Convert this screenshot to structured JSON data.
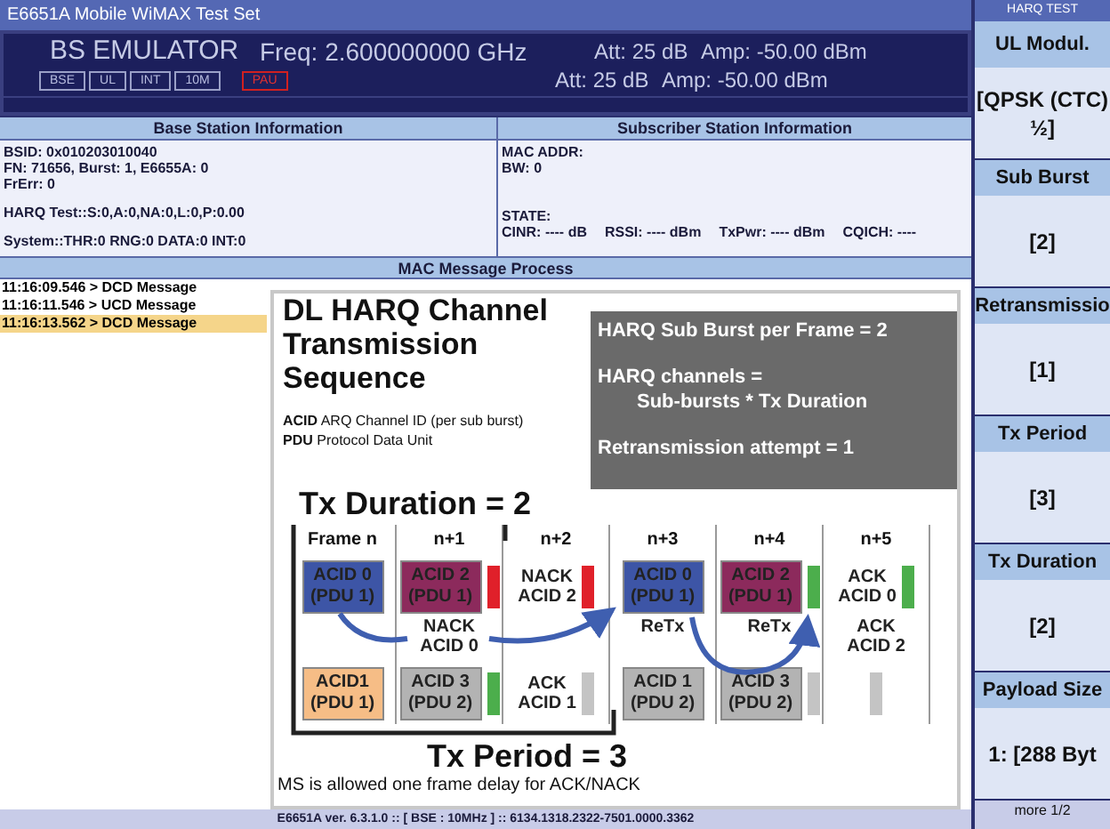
{
  "window": {
    "title": "E6651A Mobile WiMAX Test Set"
  },
  "emulator": {
    "mode": "BS EMULATOR",
    "freq": "Freq: 2.600000000 GHz",
    "lines": [
      {
        "att": "Att: 25 dB",
        "amp": "Amp: -50.00 dBm"
      },
      {
        "att": "Att: 25 dB",
        "amp": "Amp: -50.00 dBm"
      }
    ],
    "indicators": [
      {
        "label": "BSE",
        "kind": "normal"
      },
      {
        "label": "UL",
        "kind": "normal"
      },
      {
        "label": "INT",
        "kind": "normal"
      },
      {
        "label": "10M",
        "kind": "normal"
      },
      {
        "label": "PAU",
        "kind": "alert"
      }
    ]
  },
  "base_station": {
    "title": "Base Station Information",
    "groups": [
      [
        "BSID: 0x010203010040",
        "FN:   71656, Burst: 1, E6655A: 0",
        "FrErr: 0"
      ],
      [
        "HARQ Test::S:0,A:0,NA:0,L:0,P:0.00"
      ],
      [
        "System::THR:0 RNG:0 DATA:0 INT:0"
      ]
    ]
  },
  "subscriber": {
    "title": "Subscriber Station Information",
    "groups": [
      [
        "MAC ADDR:",
        "BW: 0"
      ],
      [
        "STATE:"
      ]
    ],
    "metrics": [
      "CINR: ---- dB",
      "RSSI: ---- dBm",
      "TxPwr: ---- dBm",
      "CQICH: ----"
    ]
  },
  "mac": {
    "title": "MAC Message Process",
    "messages": [
      {
        "text": "11:16:09.546 > DCD Message",
        "selected": false
      },
      {
        "text": "11:16:11.546 > UCD Message",
        "selected": false
      },
      {
        "text": "11:16:13.562 > DCD Message",
        "selected": true
      }
    ]
  },
  "slide": {
    "title": "DL HARQ Channel Transmission Sequence",
    "legend": [
      {
        "term": "ACID",
        "desc": "ARQ Channel ID (per sub burst)"
      },
      {
        "term": "PDU",
        "desc": "Protocol Data Unit"
      }
    ],
    "info": [
      "HARQ Sub Burst per Frame = 2",
      "HARQ channels =",
      "Sub-bursts * Tx Duration",
      "Retransmission attempt = 1"
    ],
    "duration": "Tx Duration = 2",
    "frames": [
      {
        "label": "Frame n",
        "upper": [
          {
            "kind": "block",
            "lines": [
              "ACID 0",
              "(PDU 1)"
            ],
            "color": "#3d55a6"
          }
        ],
        "lower": [
          {
            "kind": "block",
            "lines": [
              "ACID1",
              "(PDU 1)"
            ],
            "color": "#f6bd86"
          }
        ]
      },
      {
        "label": "n+1",
        "upper": [
          {
            "kind": "block",
            "lines": [
              "ACID 2",
              "(PDU 1)"
            ],
            "color": "#8c2a5c"
          },
          {
            "kind": "marker",
            "color": "#e0202a"
          }
        ],
        "middle": [
          {
            "kind": "note",
            "lines": [
              "NACK",
              "ACID 0"
            ]
          }
        ],
        "lower": [
          {
            "kind": "block",
            "lines": [
              "ACID 3",
              "(PDU 2)"
            ],
            "color": "#b3b3b3"
          },
          {
            "kind": "marker",
            "color": "#4cae4c"
          }
        ]
      },
      {
        "label": "n+2",
        "upper": [
          {
            "kind": "note",
            "lines": [
              "NACK",
              "ACID 2"
            ]
          },
          {
            "kind": "marker",
            "color": "#e0202a"
          }
        ],
        "lower": [
          {
            "kind": "note",
            "lines": [
              "ACK",
              "ACID 1"
            ]
          },
          {
            "kind": "marker",
            "color": "#c4c4c4"
          }
        ]
      },
      {
        "label": "n+3",
        "upper": [
          {
            "kind": "block",
            "lines": [
              "ACID 0",
              "(PDU 1)"
            ],
            "color": "#3d55a6"
          }
        ],
        "middle": [
          {
            "kind": "note",
            "lines": [
              "ReTx"
            ]
          }
        ],
        "lower": [
          {
            "kind": "block",
            "lines": [
              "ACID 1",
              "(PDU 2)"
            ],
            "color": "#b3b3b3"
          }
        ]
      },
      {
        "label": "n+4",
        "upper": [
          {
            "kind": "block",
            "lines": [
              "ACID 2",
              "(PDU 1)"
            ],
            "color": "#8c2a5c"
          },
          {
            "kind": "marker",
            "color": "#4cae4c"
          }
        ],
        "middle": [
          {
            "kind": "note",
            "lines": [
              "ReTx"
            ]
          }
        ],
        "lower": [
          {
            "kind": "block",
            "lines": [
              "ACID 3",
              "(PDU 2)"
            ],
            "color": "#b3b3b3"
          },
          {
            "kind": "marker",
            "color": "#c4c4c4"
          }
        ]
      },
      {
        "label": "n+5",
        "upper": [
          {
            "kind": "note",
            "lines": [
              "ACK",
              "ACID 0"
            ]
          },
          {
            "kind": "marker",
            "color": "#4cae4c"
          }
        ],
        "middle": [
          {
            "kind": "note",
            "lines": [
              "ACK",
              "ACID 2"
            ]
          }
        ],
        "lower": [
          {
            "kind": "marker",
            "color": "#c4c4c4"
          }
        ]
      }
    ],
    "period": "Tx Period = 3",
    "note": "MS is allowed one frame delay for ACK/NACK"
  },
  "status_bar": "E6651A ver. 6.3.1.0 :: [ BSE : 10MHz ] :: 6134.1318.2322-7501.0000.3362",
  "softkeys": {
    "title": "HARQ TEST",
    "keys": [
      {
        "label": "UL Modul.",
        "value": "[QPSK (CTC) ½]"
      },
      {
        "label": "Sub Burst",
        "value": "[2]"
      },
      {
        "label": "Retransmissio",
        "value": "[1]"
      },
      {
        "label": "Tx Period",
        "value": "[3]"
      },
      {
        "label": "Tx Duration",
        "value": "[2]"
      },
      {
        "label": "Payload Size",
        "value": "1: [288 Byt"
      }
    ],
    "more": "more 1/2"
  }
}
